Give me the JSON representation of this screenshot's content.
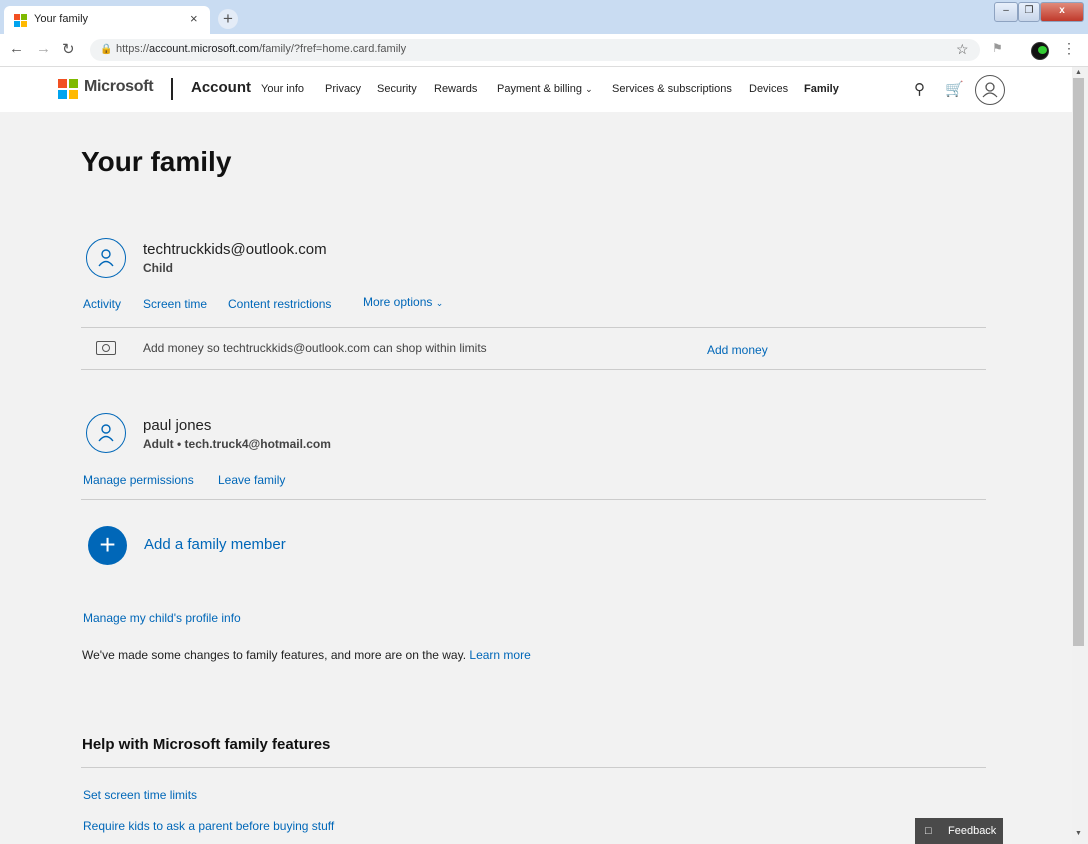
{
  "browser": {
    "tab_title": "Your family",
    "tab_close": "×",
    "new_tab": "+",
    "url_prefix": "https://",
    "url_domain": "account.microsoft.com",
    "url_path": "/family/?fref=home.card.family",
    "window_minimize": "–",
    "window_maximize": "❐",
    "window_close": "x"
  },
  "header": {
    "brand": "Microsoft",
    "account": "Account",
    "nav": [
      "Your info",
      "Privacy",
      "Security",
      "Rewards",
      "Payment & billing",
      "Services & subscriptions",
      "Devices",
      "Family"
    ],
    "active": "Family"
  },
  "page": {
    "title": "Your family"
  },
  "members": [
    {
      "name": "techtruckkids@outlook.com",
      "role": "Child",
      "links": [
        "Activity",
        "Screen time",
        "Content restrictions",
        "More options"
      ],
      "money_text": "Add money so techtruckkids@outlook.com can shop within limits",
      "money_link": "Add money"
    },
    {
      "name": "paul jones",
      "role": "Adult",
      "email": "tech.truck4@hotmail.com",
      "links": [
        "Manage permissions",
        "Leave family"
      ]
    }
  ],
  "add_member": "Add a family member",
  "manage_profile": "Manage my child's profile info",
  "notice": {
    "text": "We've made some changes to family features, and more are on the way.",
    "link": "Learn more"
  },
  "help": {
    "title": "Help with Microsoft family features",
    "links": [
      "Set screen time limits",
      "Require kids to ask a parent before buying stuff"
    ]
  },
  "feedback": "Feedback",
  "colors": {
    "accent": "#0067b8",
    "page_bg": "#f2f2f2",
    "titlebar": "#c9dcf2"
  }
}
